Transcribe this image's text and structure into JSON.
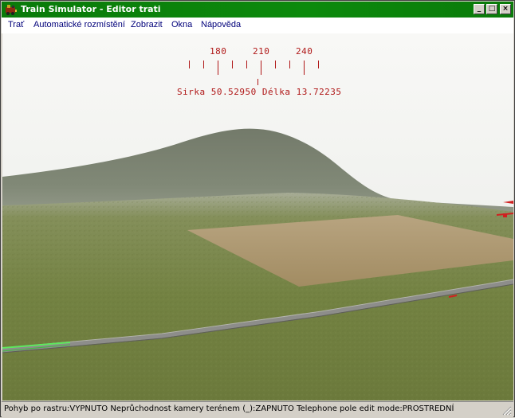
{
  "window": {
    "title": "Train Simulator - Editor trati",
    "app_icon": "train-app-icon",
    "title_bar_color": "#0b830b",
    "controls": {
      "minimize": "_",
      "maximize": "□",
      "close": "×"
    }
  },
  "menu": {
    "items": [
      {
        "label": "Trať"
      },
      {
        "label": "Automatické rozmístění"
      },
      {
        "label": "Zobrazit"
      },
      {
        "label": "Okna"
      },
      {
        "label": "Nápověda"
      }
    ]
  },
  "hud": {
    "compass_labels": [
      "180",
      "210",
      "240"
    ],
    "coordinates": "Sirka 50.52950 Délka 13.72235",
    "hud_color": "#b01818"
  },
  "status": {
    "text": "Pohyb po rastru:VYPNUTO Neprůchodnost kamery terénem (_):ZAPNUTO Telephone pole edit mode:PROSTREDNÍ"
  }
}
